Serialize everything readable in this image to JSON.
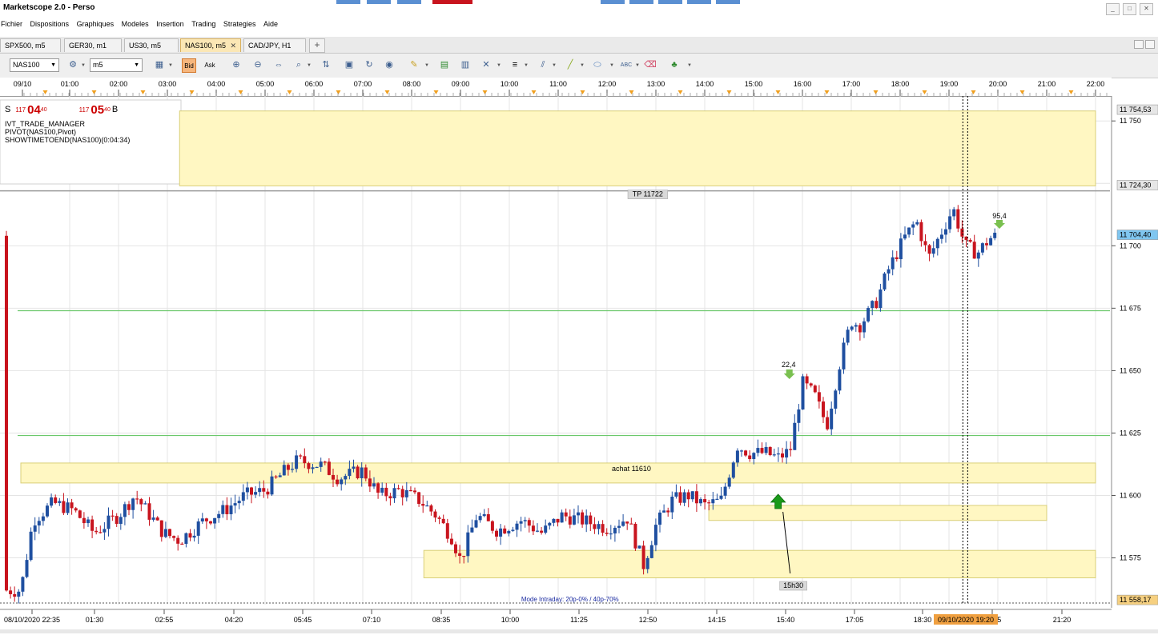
{
  "window": {
    "title": "Marketscope 2.0 - Perso",
    "controls": [
      "_",
      "□",
      "✕"
    ]
  },
  "menu": [
    "Fichier",
    "Dispositions",
    "Graphiques",
    "Modeles",
    "Insertion",
    "Trading",
    "Strategies",
    "Aide"
  ],
  "tabs": [
    {
      "label": "SPX500, m5",
      "active": false
    },
    {
      "label": "GER30, m1",
      "active": false
    },
    {
      "label": "US30, m5",
      "active": false
    },
    {
      "label": "NAS100, m5",
      "active": true,
      "close": "✕"
    },
    {
      "label": "CAD/JPY, H1",
      "active": false
    }
  ],
  "tab_add": "+",
  "toolbar": {
    "instrument": "NAS100",
    "timeframe": "m5",
    "bid_label": "Bid",
    "ask_label": "Ask"
  },
  "top_axis": {
    "labels": [
      "09/10",
      "01:00",
      "02:00",
      "03:00",
      "04:00",
      "05:00",
      "06:00",
      "07:00",
      "08:00",
      "09:00",
      "10:00",
      "11:00",
      "12:00",
      "13:00",
      "14:00",
      "15:00",
      "16:00",
      "17:00",
      "18:00",
      "19:00",
      "20:00",
      "21:00",
      "22:00"
    ]
  },
  "price_panel": {
    "s_label": "S",
    "sell_small": "117",
    "sell_big": "04",
    "sell_sup": "40",
    "buy_small": "117",
    "buy_big": "05",
    "buy_sup": "40",
    "b_label": "B"
  },
  "indicators": [
    "IVT_TRADE_MANAGER",
    "PIVOT(NAS100,Pivot)",
    "SHOWTIMETOEND(NAS100)(0:04:34)"
  ],
  "colors": {
    "bull": "#1f4fa0",
    "bear": "#c8141e",
    "zone": "#fff7c2",
    "zone_border": "#d9cf78",
    "pivot_line": "#6cc86c",
    "price_tag": "#7fc6f0"
  },
  "chart_data": {
    "type": "candlestick",
    "instrument": "NAS100",
    "timeframe": "m5",
    "ylim": [
      11555,
      11760
    ],
    "price_axis_labels": [
      "11 750",
      "11 700",
      "11 675",
      "11 650",
      "11 625",
      "11 600",
      "11 575"
    ],
    "price_tags": {
      "top": "11 754,53",
      "tp": "11 724,30",
      "current": "11 704,40",
      "bottom": "11 558,17"
    },
    "annotations": {
      "tp_label": "TP 11722",
      "entry_label": "achat 11610",
      "time_label": "15h30",
      "marker_a": "22,4",
      "marker_b": "95,4",
      "mode_text": "Mode Intraday: 20p-0% / 40p-70%"
    },
    "levels": {
      "tp_price": 11722,
      "entry_price": 11610,
      "pivot_upper": 11674,
      "pivot_lower": 11624
    },
    "zones": [
      {
        "from": 11724,
        "to": 11754,
        "start_time": "03:15",
        "end_time": "22:00"
      },
      {
        "from": 11605,
        "to": 11613,
        "start_time": "00:00",
        "end_time": "22:00"
      },
      {
        "from": 11590,
        "to": 11596,
        "start_time": "14:05",
        "end_time": "21:00"
      },
      {
        "from": 11567,
        "to": 11578,
        "start_time": "08:15",
        "end_time": "22:00"
      }
    ],
    "close_path": [
      [
        "00:00",
        11562
      ],
      [
        "00:15",
        11590
      ],
      [
        "00:40",
        11597
      ],
      [
        "01:05",
        11594
      ],
      [
        "01:30",
        11585
      ],
      [
        "02:00",
        11592
      ],
      [
        "02:20",
        11600
      ],
      [
        "02:55",
        11585
      ],
      [
        "03:15",
        11582
      ],
      [
        "03:45",
        11590
      ],
      [
        "04:10",
        11594
      ],
      [
        "04:35",
        11600
      ],
      [
        "05:00",
        11602
      ],
      [
        "05:25",
        11610
      ],
      [
        "05:40",
        11614
      ],
      [
        "06:10",
        11612
      ],
      [
        "06:30",
        11607
      ],
      [
        "07:00",
        11610
      ],
      [
        "07:20",
        11600
      ],
      [
        "07:45",
        11602
      ],
      [
        "08:10",
        11598
      ],
      [
        "08:30",
        11592
      ],
      [
        "08:50",
        11583
      ],
      [
        "09:00",
        11574
      ],
      [
        "09:20",
        11592
      ],
      [
        "09:45",
        11586
      ],
      [
        "10:15",
        11590
      ],
      [
        "10:40",
        11585
      ],
      [
        "11:05",
        11592
      ],
      [
        "11:30",
        11590
      ],
      [
        "12:00",
        11587
      ],
      [
        "12:25",
        11591
      ],
      [
        "12:45",
        11572
      ],
      [
        "13:00",
        11588
      ],
      [
        "13:20",
        11598
      ],
      [
        "13:40",
        11600
      ],
      [
        "14:00",
        11596
      ],
      [
        "14:20",
        11598
      ],
      [
        "14:40",
        11620
      ],
      [
        "14:55",
        11617
      ],
      [
        "15:15",
        11617
      ],
      [
        "15:30",
        11615
      ],
      [
        "15:45",
        11618
      ],
      [
        "16:00",
        11645
      ],
      [
        "16:15",
        11640
      ],
      [
        "16:30",
        11628
      ],
      [
        "16:45",
        11652
      ],
      [
        "17:00",
        11670
      ],
      [
        "17:10",
        11668
      ],
      [
        "17:30",
        11677
      ],
      [
        "17:45",
        11690
      ],
      [
        "18:05",
        11703
      ],
      [
        "18:20",
        11710
      ],
      [
        "18:35",
        11695
      ],
      [
        "18:50",
        11705
      ],
      [
        "19:05",
        11715
      ],
      [
        "19:20",
        11700
      ],
      [
        "19:35",
        11697
      ],
      [
        "19:50",
        11703
      ],
      [
        "20:00",
        11704
      ]
    ],
    "bottom_axis": {
      "labels": [
        "08/10/2020 22:35",
        "01:30",
        "02:55",
        "04:20",
        "05:45",
        "07:10",
        "08:35",
        "10:00",
        "11:25",
        "12:50",
        "14:15",
        "15:40",
        "17:05",
        "18:30",
        "19:55",
        "21:20"
      ],
      "cursor_label": "09/10/2020 19:20"
    },
    "grid": true
  }
}
